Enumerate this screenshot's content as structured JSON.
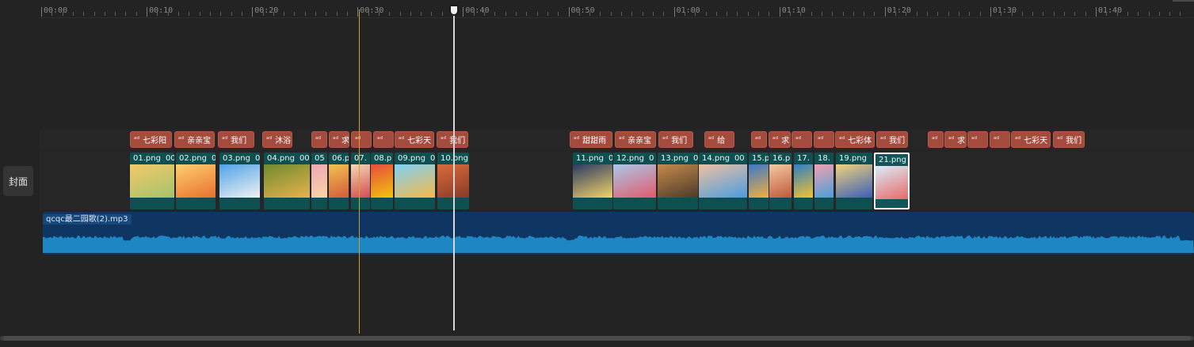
{
  "ruler": {
    "major_labels": [
      "00:00",
      "00:10",
      "00:20",
      "00:30",
      "00:40",
      "00:50",
      "01:00",
      "01:10",
      "01:20",
      "01:30",
      "01:40"
    ]
  },
  "cover_button": {
    "label": "封面"
  },
  "playhead": {
    "time": "00:40"
  },
  "sticker_icon_glyph": "ᵃᵈ",
  "stickers": [
    {
      "label": "七彩阳"
    },
    {
      "label": "亲亲宝"
    },
    {
      "label": "我们"
    },
    {
      "label": "沐浴"
    },
    {
      "label": ""
    },
    {
      "label": "求"
    },
    {
      "label": ""
    },
    {
      "label": ""
    },
    {
      "label": "七彩天"
    },
    {
      "label": "我们"
    },
    {
      "label": "甜甜雨"
    },
    {
      "label": "亲亲宝"
    },
    {
      "label": "我们"
    },
    {
      "label": "给"
    },
    {
      "label": ""
    },
    {
      "label": "求"
    },
    {
      "label": ""
    },
    {
      "label": ""
    },
    {
      "label": "七彩体"
    },
    {
      "label": "我们"
    },
    {
      "label": ""
    },
    {
      "label": "求"
    },
    {
      "label": ""
    },
    {
      "label": ""
    },
    {
      "label": "七彩天"
    },
    {
      "label": "我们"
    }
  ],
  "clips": [
    {
      "name": "01.png",
      "duration": "00"
    },
    {
      "name": "02.png",
      "duration": "0"
    },
    {
      "name": "03.png",
      "duration": "0"
    },
    {
      "name": "04.png",
      "duration": "00"
    },
    {
      "name": "05",
      "duration": ""
    },
    {
      "name": "06.p",
      "duration": ""
    },
    {
      "name": "07.",
      "duration": ""
    },
    {
      "name": "08.p",
      "duration": ""
    },
    {
      "name": "09.png",
      "duration": "0"
    },
    {
      "name": "10.png",
      "duration": ""
    },
    {
      "name": "11.png",
      "duration": "0"
    },
    {
      "name": "12.png",
      "duration": "0"
    },
    {
      "name": "13.png",
      "duration": "0"
    },
    {
      "name": "14.png",
      "duration": "00"
    },
    {
      "name": "15.p",
      "duration": ""
    },
    {
      "name": "16.p",
      "duration": ""
    },
    {
      "name": "17.",
      "duration": ""
    },
    {
      "name": "18.",
      "duration": ""
    },
    {
      "name": "19.png",
      "duration": ""
    },
    {
      "name": "21.png",
      "duration": "",
      "selected": true
    }
  ],
  "audio": {
    "filename": "qcqc最二园歌(2).mp3"
  },
  "colors": {
    "sticker": "#a34b3c",
    "clip": "#0e4f52",
    "audio_bg": "#0f3663",
    "waveform": "#1e86c2",
    "playhead": "#d8d8d8",
    "marker": "#c9a22a"
  }
}
